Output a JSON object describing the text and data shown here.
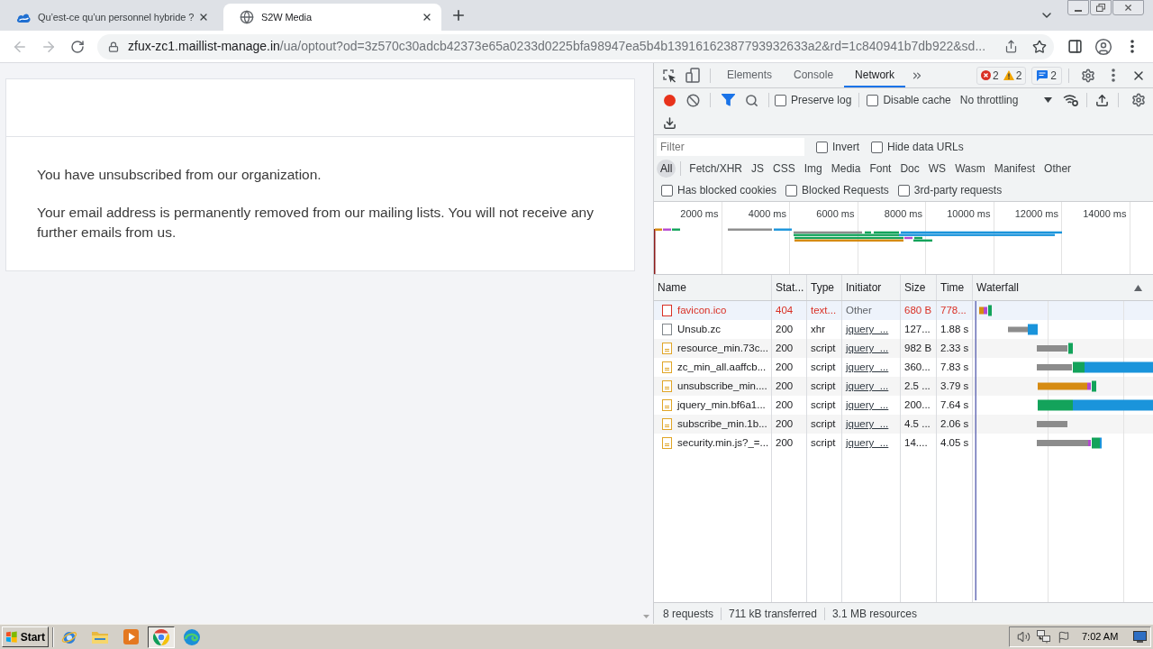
{
  "browser": {
    "tabs": [
      {
        "title": "Qu’est-ce qu’un personnel hybride ?",
        "selected": false
      },
      {
        "title": "S2W Media",
        "selected": true
      }
    ],
    "can_go_back": false,
    "can_go_forward": false,
    "url": {
      "host": "zfux-zc1.maillist-manage.in",
      "path": "/ua/optout?od=3z570c30adcb42373e65a0233d0225bfa98947ea5b4b13916162387793932633a2&rd=1c840941b7db922&sd..."
    }
  },
  "page": {
    "paragraphs": [
      "You have unsubscribed from our organization.",
      "Your email address is permanently removed from our mailing lists. You will not receive any further emails from us."
    ]
  },
  "devtools": {
    "panel_tabs": [
      {
        "label": "Elements",
        "selected": false
      },
      {
        "label": "Console",
        "selected": false
      },
      {
        "label": "Network",
        "selected": true
      }
    ],
    "issues": {
      "errors": "2",
      "warnings": "2",
      "messages": "2"
    },
    "recording": true,
    "filter_shown": true,
    "options": [
      {
        "label": "Preserve log",
        "checked": false
      },
      {
        "label": "Disable cache",
        "checked": false
      }
    ],
    "throttling": "No throttling",
    "filter": {
      "placeholder": "Filter",
      "options": [
        {
          "label": "Invert",
          "checked": false
        },
        {
          "label": "Hide data URLs",
          "checked": false
        }
      ]
    },
    "type_filters": [
      {
        "label": "All",
        "selected": true
      },
      {
        "label": "Fetch/XHR",
        "selected": false
      },
      {
        "label": "JS",
        "selected": false
      },
      {
        "label": "CSS",
        "selected": false
      },
      {
        "label": "Img",
        "selected": false
      },
      {
        "label": "Media",
        "selected": false
      },
      {
        "label": "Font",
        "selected": false
      },
      {
        "label": "Doc",
        "selected": false
      },
      {
        "label": "WS",
        "selected": false
      },
      {
        "label": "Wasm",
        "selected": false
      },
      {
        "label": "Manifest",
        "selected": false
      },
      {
        "label": "Other",
        "selected": false
      }
    ],
    "request_filters": [
      {
        "label": "Has blocked cookies",
        "checked": false
      },
      {
        "label": "Blocked Requests",
        "checked": false
      },
      {
        "label": "3rd-party requests",
        "checked": false
      }
    ],
    "overview": {
      "ticks": [
        "2000 ms",
        "4000 ms",
        "6000 ms",
        "8000 ms",
        "10000 ms",
        "12000 ms",
        "14000 ms"
      ]
    },
    "table": {
      "columns": [
        "Name",
        "Stat...",
        "Type",
        "Initiator",
        "Size",
        "Time",
        "Waterfall"
      ],
      "rows": [
        {
          "name": "favicon.ico",
          "status": "404",
          "type": "text...",
          "initiator": "Other",
          "size": "680 B",
          "time": "778...",
          "kind": "document",
          "failed": true,
          "initiator_link": false,
          "highlighted": true
        },
        {
          "name": "Unsub.zc",
          "status": "200",
          "type": "xhr",
          "initiator": "jquery_...",
          "size": "127...",
          "time": "1.88 s",
          "kind": "document",
          "failed": false,
          "initiator_link": true,
          "highlighted": false
        },
        {
          "name": "resource_min.73c...",
          "status": "200",
          "type": "script",
          "initiator": "jquery_...",
          "size": "982 B",
          "time": "2.33 s",
          "kind": "script",
          "failed": false,
          "initiator_link": true,
          "highlighted": false
        },
        {
          "name": "zc_min_all.aaffcb...",
          "status": "200",
          "type": "script",
          "initiator": "jquery_...",
          "size": "360...",
          "time": "7.83 s",
          "kind": "script",
          "failed": false,
          "initiator_link": true,
          "highlighted": false
        },
        {
          "name": "unsubscribe_min....",
          "status": "200",
          "type": "script",
          "initiator": "jquery_...",
          "size": "2.5 ...",
          "time": "3.79 s",
          "kind": "script",
          "failed": false,
          "initiator_link": true,
          "highlighted": false
        },
        {
          "name": "jquery_min.bf6a1...",
          "status": "200",
          "type": "script",
          "initiator": "jquery_...",
          "size": "200...",
          "time": "7.64 s",
          "kind": "script",
          "failed": false,
          "initiator_link": true,
          "highlighted": false
        },
        {
          "name": "subscribe_min.1b...",
          "status": "200",
          "type": "script",
          "initiator": "jquery_...",
          "size": "4.5 ...",
          "time": "2.06 s",
          "kind": "script",
          "failed": false,
          "initiator_link": true,
          "highlighted": false
        },
        {
          "name": "security.min.js?_=...",
          "status": "200",
          "type": "script",
          "initiator": "jquery_...",
          "size": "14....",
          "time": "4.05 s",
          "kind": "script",
          "failed": false,
          "initiator_link": true,
          "highlighted": false
        }
      ]
    },
    "status": [
      "8 requests",
      "711 kB transferred",
      "3.1 MB resources"
    ]
  },
  "taskbar": {
    "start": "Start",
    "apps": [
      {
        "kind": "orbit",
        "active": false
      },
      {
        "kind": "folder",
        "active": false
      },
      {
        "kind": "player",
        "active": false
      },
      {
        "kind": "ring",
        "active": true
      },
      {
        "kind": "swirl",
        "active": false
      }
    ],
    "clock": "7:02 AM"
  }
}
